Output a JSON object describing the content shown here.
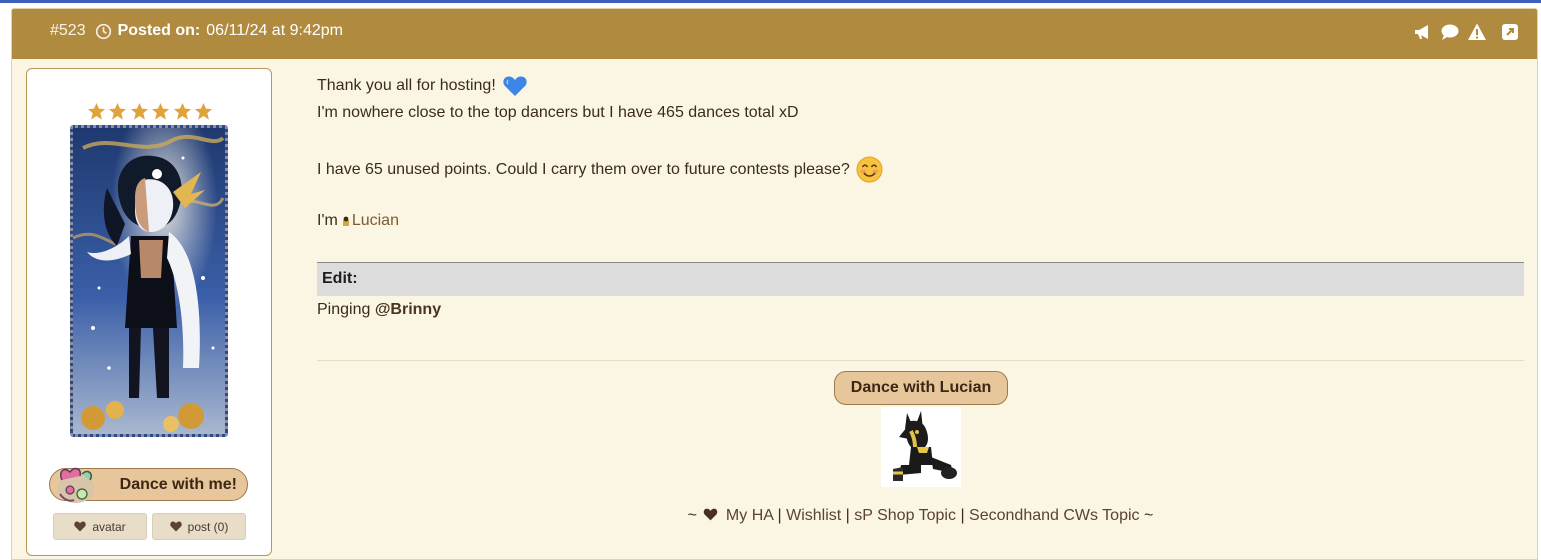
{
  "post": {
    "number": "#523",
    "posted_label": "Posted on:",
    "posted_date": "06/11/24 at 9:42pm",
    "header_icons": [
      "megaphone-icon",
      "speech-bubble-icon",
      "warning-icon",
      "external-link-icon"
    ]
  },
  "sidebar": {
    "stars": 6,
    "dance_me_label": "Dance with me!",
    "avatar_button_label": "avatar",
    "post_button_label": "post (0)"
  },
  "content": {
    "line1": "Thank you all for hosting!",
    "line2": "I'm nowhere close to the top dancers but I have 465 dances total xD",
    "line3": "I have 65 unused points. Could I carry them over to future contests please?",
    "line4_prefix": "I'm",
    "line4_user": "Lucian",
    "edit_label": "Edit:",
    "ping_prefix": "Pinging",
    "ping_mention": "@Brinny"
  },
  "signature": {
    "dance_button_label": "Dance with Lucian",
    "prefix": "~",
    "link_my_ha": "My HA",
    "sep": "|",
    "link_wishlist": "Wishlist",
    "link_sp_shop": "sP Shop Topic",
    "link_secondhand": "Secondhand CWs Topic",
    "suffix": "~"
  },
  "colors": {
    "header_bg": "#b08a3e",
    "post_bg": "#fbf6e4",
    "button_bg": "#e6c69a",
    "edit_bar_bg": "#dcdcdc"
  }
}
